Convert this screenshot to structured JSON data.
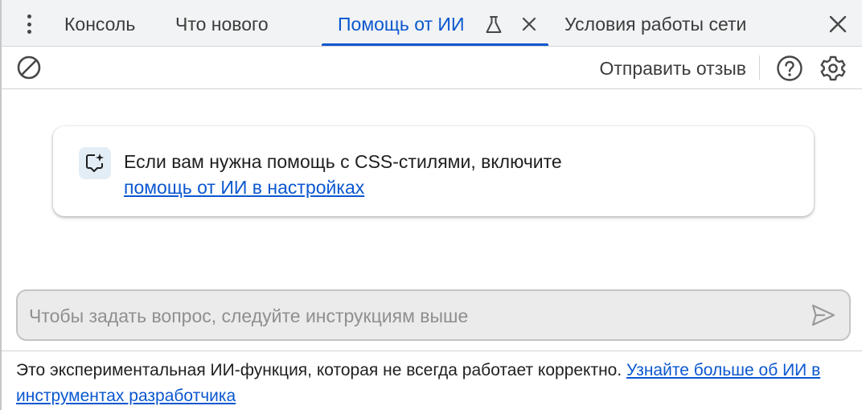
{
  "tabs": [
    {
      "label": "Консоль"
    },
    {
      "label": "Что нового"
    },
    {
      "label": "Помощь от ИИ"
    },
    {
      "label": "Условия работы сети"
    }
  ],
  "toolbar": {
    "feedback_label": "Отправить отзыв"
  },
  "card": {
    "message": "Если вам нужна помощь с CSS-стилями, включите",
    "link_text": "помощь от ИИ в настройках"
  },
  "prompt": {
    "placeholder": "Чтобы задать вопрос, следуйте инструкциям выше",
    "value": ""
  },
  "footer": {
    "disclaimer": "Это экспериментальная ИИ-функция, которая не всегда работает корректно. ",
    "link_text": "Узнайте больше об ИИ в инструментах разработчика"
  },
  "colors": {
    "accent": "#0b57d0",
    "tabbar_bg": "#f1f3f4",
    "input_bg": "#ebebeb",
    "icon": "#474747"
  },
  "icons": [
    "more-vert-icon",
    "flask-icon",
    "close-icon",
    "clear-icon",
    "help-icon",
    "gear-icon",
    "spark-chat-icon",
    "send-icon"
  ]
}
